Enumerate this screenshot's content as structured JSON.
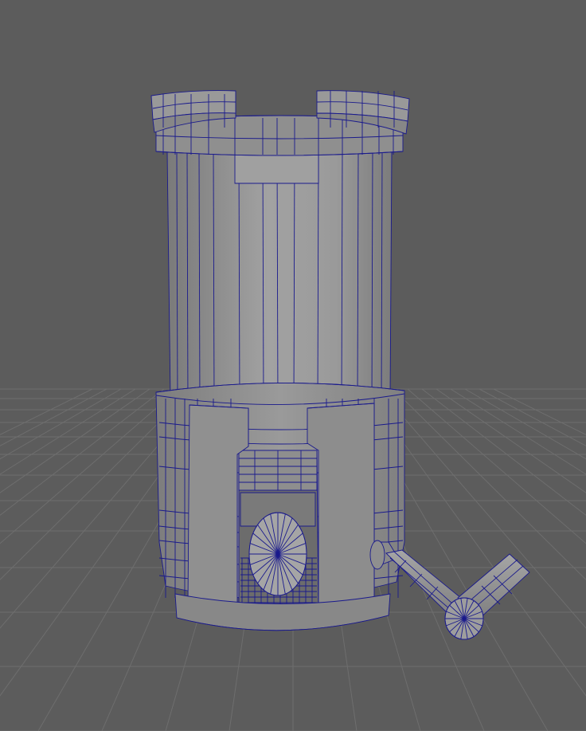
{
  "viewport": {
    "background_color": "#5c5c5c",
    "grid_color": "#6e6e6e",
    "wire_color": "#1a1a8c",
    "shade_light": "#9b9b9b",
    "shade_mid": "#8a8a8a",
    "shade_dark": "#6f6f6f",
    "camera_label": ""
  },
  "scene": {
    "object": "cylindrical-tower-model",
    "display_mode": "wireframe-on-shaded"
  }
}
